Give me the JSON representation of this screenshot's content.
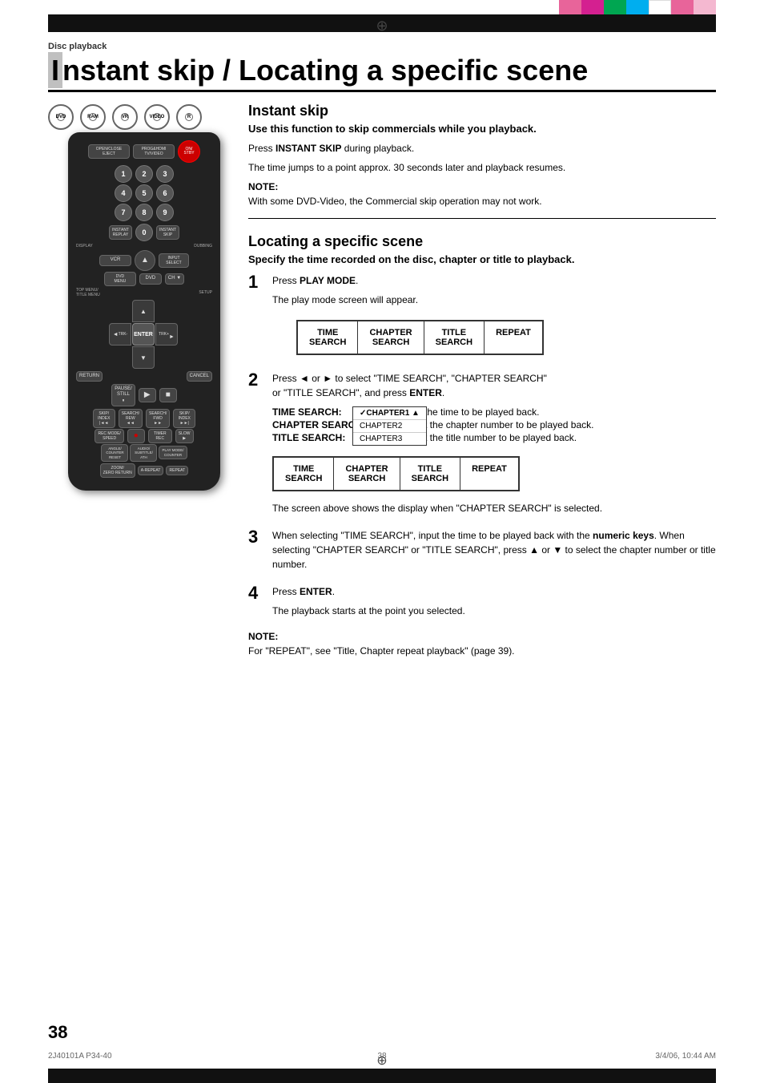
{
  "page": {
    "header": "Disc playback",
    "title_part1": "I",
    "title_part2": "nstant skip / Locating a specific scene",
    "page_number": "38",
    "footer_left": "2J40101A P34-40",
    "footer_center": "38",
    "footer_right": "3/4/06, 10:44 AM"
  },
  "disc_icons": [
    {
      "label": "DVD"
    },
    {
      "label": "RAM"
    },
    {
      "label": "VR"
    },
    {
      "label": "VIDEO"
    },
    {
      "label": "R"
    }
  ],
  "instant_skip": {
    "title": "Instant skip",
    "subtitle": "Use this function to skip commercials while you playback.",
    "body1_prefix": "Press ",
    "body1_bold": "INSTANT SKIP",
    "body1_suffix": " during playback.",
    "body2": "The time jumps to a point approx. 30 seconds later and playback resumes.",
    "note_label": "NOTE:",
    "note_text": "With some DVD-Video, the Commercial skip operation may not work."
  },
  "locating": {
    "title": "Locating a specific scene",
    "subtitle": "Specify the time recorded on the disc, chapter or title to playback.",
    "step1": {
      "number": "1",
      "prefix": "Press ",
      "bold": "PLAY MODE",
      "suffix": ".",
      "detail": "The play mode screen will appear."
    },
    "screen1": {
      "cells": [
        {
          "line1": "TIME",
          "line2": "SEARCH"
        },
        {
          "line1": "CHAPTER",
          "line2": "SEARCH"
        },
        {
          "line1": "TITLE",
          "line2": "SEARCH"
        },
        {
          "line1": "REPEAT",
          "line2": ""
        }
      ]
    },
    "step2": {
      "number": "2",
      "prefix": "Press ",
      "symbol1": "◄",
      "middle": " or ",
      "symbol2": "►",
      "text1": " to select \"TIME SEARCH\", \"CHAPTER SEARCH\"",
      "text2": "or \"TITLE SEARCH\", and press ",
      "bold": "ENTER",
      "suffix": "."
    },
    "search_types": [
      {
        "label": "TIME SEARCH:",
        "desc": "      Input the time to be played back."
      },
      {
        "label": "CHAPTER SEARCH:",
        "desc": " Select the chapter number to be played back."
      },
      {
        "label": "TITLE SEARCH:",
        "desc": "      Select the title number to be played back."
      }
    ],
    "screen2": {
      "dropdown": [
        "✓CHAPTER1 ▲",
        "CHAPTER2",
        "CHAPTER3"
      ],
      "cells": [
        {
          "line1": "TIME",
          "line2": "SEARCH"
        },
        {
          "line1": "CHAPTER",
          "line2": "SEARCH"
        },
        {
          "line1": "TITLE",
          "line2": "SEARCH"
        },
        {
          "line1": "REPEAT",
          "line2": ""
        }
      ]
    },
    "screen2_caption": "The screen above shows the display when \"CHAPTER SEARCH\" is selected.",
    "step3": {
      "number": "3",
      "text1": "When selecting \"TIME SEARCH\", input the time to be played back with the ",
      "bold1": "numeric keys",
      "text2": ". When selecting \"CHAPTER SEARCH\" or \"TITLE SEARCH\", press ▲ or ▼ to select the chapter number or title number."
    },
    "step4": {
      "number": "4",
      "prefix": "Press ",
      "bold": "ENTER",
      "suffix": ".",
      "detail": "The playback starts at the point you selected."
    },
    "note_label": "NOTE:",
    "note_text": "For \"REPEAT\", see \"Title, Chapter repeat playback\" (page 39)."
  },
  "remote": {
    "rows": [
      [
        "OPEN/CLOSE EJECT",
        "PROG&HDMI TV/VIDEO",
        "ON/STANDBY"
      ],
      [
        "1",
        "2",
        "3"
      ],
      [
        "4",
        "5",
        "6"
      ],
      [
        "7",
        "8",
        "9"
      ],
      [
        "INSTANT REPLAY",
        "0",
        "INSTANT SKIP"
      ],
      [
        "DISPLAY",
        "",
        "DUBBING"
      ],
      [
        "VCR",
        "▲",
        ""
      ],
      [
        "DVD MENU",
        "DVD",
        "CH ▼",
        "INPUT SELECT"
      ],
      [
        "TOP MENU/TITLE MENU",
        "",
        "SETUP"
      ],
      [
        "◄TRK-",
        "ENTER",
        "TRK+►"
      ],
      [
        "RETURN",
        "▼",
        "CANCEL"
      ],
      [
        "PAUSE/STILL",
        "PLAY",
        "STOP"
      ],
      [
        "SKIP/INDEX",
        "SEARCH/REW",
        "SEARCH/FWD",
        "SKIP/INDEX"
      ],
      [
        "REC MODE/SPEED",
        "●",
        "TIMER REC",
        "SLOW"
      ],
      [
        "ANGLE/COUNTER RESET",
        "AUDIO/SUBTITLE/ATH",
        "PLAY MODE/COUNTER"
      ],
      [
        "ZOOM/ZERO RETURN",
        "A-REPEAT",
        "REPEAT"
      ]
    ]
  }
}
